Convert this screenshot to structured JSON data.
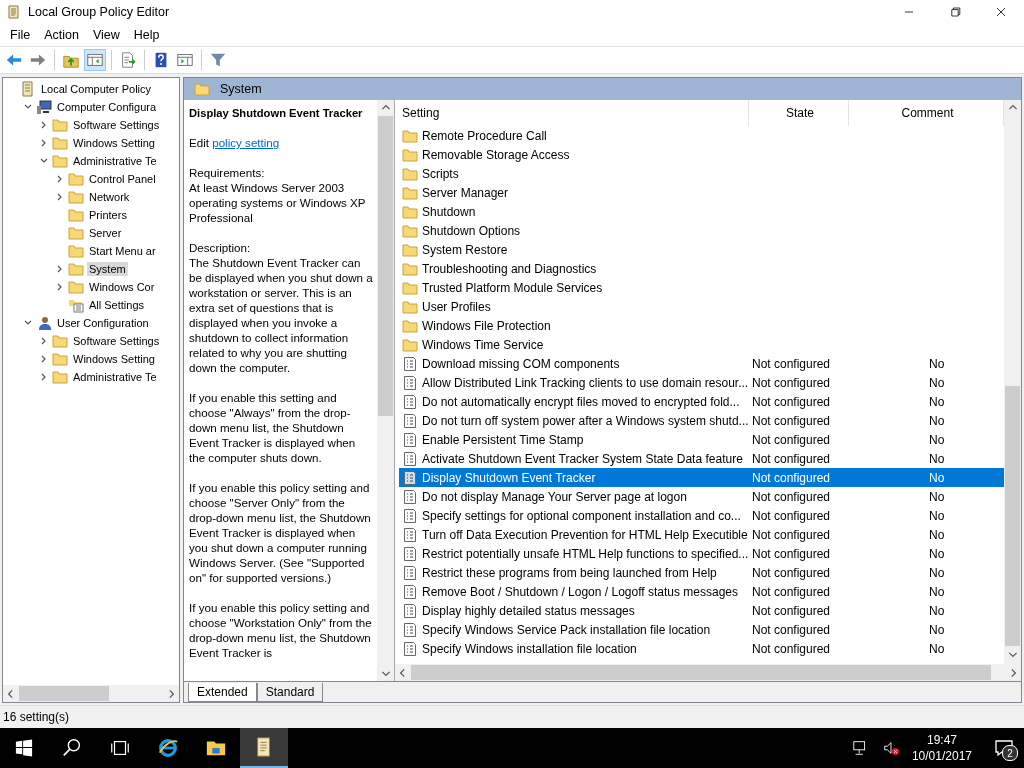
{
  "window": {
    "title": "Local Group Policy Editor"
  },
  "menu": [
    "File",
    "Action",
    "View",
    "Help"
  ],
  "toolbar": [
    {
      "pressed": false
    },
    {
      "pressed": false
    },
    {
      "pressed": false
    },
    {
      "pressed": true
    },
    {
      "pressed": false
    },
    {
      "pressed": false
    },
    {
      "pressed": false
    },
    {
      "pressed": false
    }
  ],
  "tree": [
    {
      "label": "Local Computer Policy",
      "kind": "policy",
      "selected": false,
      "children": [
        {
          "label": "Computer Configura",
          "kind": "computer",
          "expanded": true,
          "selected": false,
          "children": [
            {
              "label": "Software Settings",
              "kind": "folder",
              "expanded": false,
              "selected": false
            },
            {
              "label": "Windows Setting",
              "kind": "folder",
              "expanded": false,
              "selected": false
            },
            {
              "label": "Administrative Te",
              "kind": "folder",
              "expanded": true,
              "selected": false,
              "children": [
                {
                  "label": "Control Panel",
                  "kind": "folder",
                  "expanded": false,
                  "selected": false
                },
                {
                  "label": "Network",
                  "kind": "folder",
                  "expanded": false,
                  "selected": false
                },
                {
                  "label": "Printers",
                  "kind": "folder",
                  "selected": false
                },
                {
                  "label": "Server",
                  "kind": "folder",
                  "selected": false
                },
                {
                  "label": "Start Menu ar",
                  "kind": "folder",
                  "selected": false
                },
                {
                  "label": "System",
                  "kind": "folder",
                  "expanded": false,
                  "selected": true
                },
                {
                  "label": "Windows Cor",
                  "kind": "folder",
                  "expanded": false,
                  "selected": false
                },
                {
                  "label": "All Settings",
                  "kind": "settings",
                  "selected": false
                }
              ]
            }
          ]
        },
        {
          "label": "User Configuration",
          "kind": "user",
          "expanded": true,
          "selected": false,
          "children": [
            {
              "label": "Software Settings",
              "kind": "folder",
              "expanded": false,
              "selected": false
            },
            {
              "label": "Windows Setting",
              "kind": "folder",
              "expanded": false,
              "selected": false
            },
            {
              "label": "Administrative Te",
              "kind": "folder",
              "expanded": false,
              "selected": false
            }
          ]
        }
      ]
    }
  ],
  "header": {
    "title": "System"
  },
  "description": {
    "title": "Display Shutdown Event Tracker",
    "edit": "Edit",
    "link": "policy setting ",
    "requirements_label": "Requirements:",
    "requirements": "At least Windows Server 2003 operating systems or Windows XP Professional",
    "description_label": "Description:",
    "paragraphs": [
      "The Shutdown Event Tracker can be displayed when you shut down a workstation or server.  This is an extra set of questions that is displayed when you invoke a shutdown to collect information related to why you are shutting down the computer.",
      "If you enable this setting and choose \"Always\" from the drop-down menu list, the Shutdown Event Tracker is displayed when the computer shuts down.",
      "If you enable this policy setting and choose \"Server Only\" from the drop-down menu list, the Shutdown Event Tracker is displayed when you shut down a computer running Windows Server. (See \"Supported on\" for supported versions.)",
      "If you enable this policy setting and choose \"Workstation Only\" from the drop-down menu list, the Shutdown Event Tracker is"
    ]
  },
  "table": {
    "columns": [
      "Setting",
      "State",
      "Comment"
    ],
    "rows": [
      {
        "kind": "folder",
        "setting": "Remote Procedure Call",
        "selected": false
      },
      {
        "kind": "folder",
        "setting": "Removable Storage Access",
        "selected": false
      },
      {
        "kind": "folder",
        "setting": "Scripts",
        "selected": false
      },
      {
        "kind": "folder",
        "setting": "Server Manager",
        "selected": false
      },
      {
        "kind": "folder",
        "setting": "Shutdown",
        "selected": false
      },
      {
        "kind": "folder",
        "setting": "Shutdown Options",
        "selected": false
      },
      {
        "kind": "folder",
        "setting": "System Restore",
        "selected": false
      },
      {
        "kind": "folder",
        "setting": "Troubleshooting and Diagnostics",
        "selected": false
      },
      {
        "kind": "folder",
        "setting": "Trusted Platform Module Services",
        "selected": false
      },
      {
        "kind": "folder",
        "setting": "User Profiles",
        "selected": false
      },
      {
        "kind": "folder",
        "setting": "Windows File Protection",
        "selected": false
      },
      {
        "kind": "folder",
        "setting": "Windows Time Service",
        "selected": false
      },
      {
        "kind": "policy",
        "setting": "Download missing COM components",
        "state": "Not configured",
        "comment": "No",
        "selected": false
      },
      {
        "kind": "policy",
        "setting": "Allow Distributed Link Tracking clients to use domain resour...",
        "state": "Not configured",
        "comment": "No",
        "selected": false
      },
      {
        "kind": "policy",
        "setting": "Do not automatically encrypt files moved to encrypted fold...",
        "state": "Not configured",
        "comment": "No",
        "selected": false
      },
      {
        "kind": "policy",
        "setting": "Do not turn off system power after a Windows system shutd...",
        "state": "Not configured",
        "comment": "No",
        "selected": false
      },
      {
        "kind": "policy",
        "setting": "Enable Persistent Time Stamp",
        "state": "Not configured",
        "comment": "No",
        "selected": false
      },
      {
        "kind": "policy",
        "setting": "Activate Shutdown Event Tracker System State Data feature",
        "state": "Not configured",
        "comment": "No",
        "selected": false
      },
      {
        "kind": "policy",
        "setting": "Display Shutdown Event Tracker",
        "state": "Not configured",
        "comment": "No",
        "selected": true
      },
      {
        "kind": "policy",
        "setting": "Do not display Manage Your Server page at logon",
        "state": "Not configured",
        "comment": "No",
        "selected": false
      },
      {
        "kind": "policy",
        "setting": "Specify settings for optional component installation and co...",
        "state": "Not configured",
        "comment": "No",
        "selected": false
      },
      {
        "kind": "policy",
        "setting": "Turn off Data Execution Prevention for HTML Help Executible",
        "state": "Not configured",
        "comment": "No",
        "selected": false
      },
      {
        "kind": "policy",
        "setting": "Restrict potentially unsafe HTML Help functions to specified...",
        "state": "Not configured",
        "comment": "No",
        "selected": false
      },
      {
        "kind": "policy",
        "setting": "Restrict these programs from being launched from Help",
        "state": "Not configured",
        "comment": "No",
        "selected": false
      },
      {
        "kind": "policy",
        "setting": "Remove Boot / Shutdown / Logon / Logoff status messages",
        "state": "Not configured",
        "comment": "No",
        "selected": false
      },
      {
        "kind": "policy",
        "setting": "Display highly detailed status messages",
        "state": "Not configured",
        "comment": "No",
        "selected": false
      },
      {
        "kind": "policy",
        "setting": "Specify Windows Service Pack installation file location",
        "state": "Not configured",
        "comment": "No",
        "selected": false
      },
      {
        "kind": "policy",
        "setting": "Specify Windows installation file location",
        "state": "Not configured",
        "comment": "No",
        "selected": false
      }
    ]
  },
  "tabs": [
    {
      "label": "Extended",
      "selected": true
    },
    {
      "label": "Standard",
      "selected": false
    }
  ],
  "status_bar": "16 setting(s)",
  "taskbar": {
    "apps": [
      {
        "active": false
      },
      {
        "active": false
      },
      {
        "active": false
      },
      {
        "active": false
      },
      {
        "active": true
      }
    ],
    "time": "19:47",
    "date": "10/01/2017",
    "notifications": "2"
  }
}
